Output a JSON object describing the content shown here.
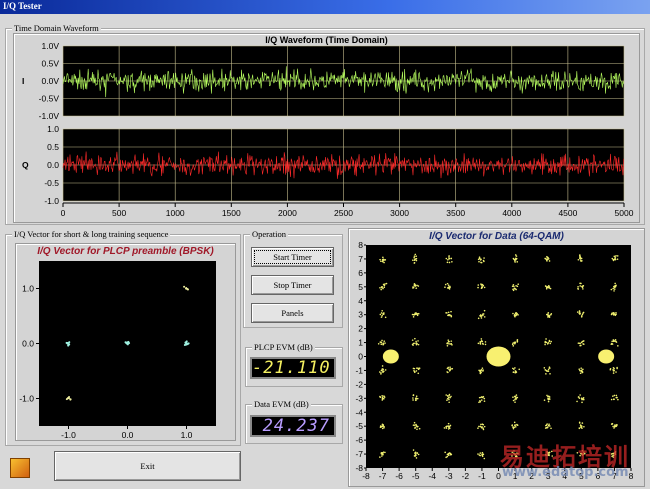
{
  "window": {
    "title": "I/Q Tester"
  },
  "time_group": {
    "label": "Time Domain Waveform",
    "chart_title": "I/Q Waveform (Time Domain)",
    "i_label": "I",
    "q_label": "Q",
    "i_ticks": [
      "1.0V",
      "0.5V",
      "0.0V",
      "-0.5V",
      "-1.0V"
    ],
    "q_ticks": [
      "1.0",
      "0.5",
      "0.0",
      "-0.5",
      "-1.0"
    ],
    "x_ticks": [
      "0",
      "500",
      "1000",
      "1500",
      "2000",
      "2500",
      "3000",
      "3500",
      "4000",
      "4500",
      "5000"
    ],
    "colors": {
      "i": "#b8ff60",
      "q": "#ff2a2a",
      "grid": "#c8c090"
    }
  },
  "preamble_group": {
    "label": "I/Q Vector for short & long training sequence",
    "chart_title": "I/Q Vector for PLCP preamble (BPSK)",
    "y_ticks": [
      "1.0",
      "0.0",
      "-1.0"
    ],
    "x_ticks": [
      "-1.0",
      "0.0",
      "1.0"
    ]
  },
  "operation": {
    "label": "Operation",
    "start": "Start Timer",
    "stop": "Stop Timer",
    "panels": "Panels"
  },
  "plcp_evm": {
    "label": "PLCP EVM (dB)",
    "value": "-21.110",
    "color": "#f4f060"
  },
  "data_evm": {
    "label": "Data EVM (dB)",
    "value": "24.237",
    "color": "#b89cff"
  },
  "exit": {
    "label": "Exit"
  },
  "qam": {
    "chart_title": "I/Q Vector for Data (64-QAM)",
    "y_ticks": [
      "8",
      "7",
      "6",
      "5",
      "4",
      "3",
      "2",
      "1",
      "0",
      "-1",
      "-2",
      "-3",
      "-4",
      "-5",
      "-6",
      "-7",
      "-8"
    ],
    "x_ticks": [
      "-8",
      "-7",
      "-6",
      "-5",
      "-4",
      "-3",
      "-2",
      "-1",
      "0",
      "1",
      "2",
      "3",
      "4",
      "5",
      "6",
      "7",
      "8"
    ]
  },
  "watermark": {
    "cn": "易迪拓培训",
    "url": "www.edatop.com"
  },
  "chart_data": [
    {
      "type": "line",
      "title": "I/Q Waveform (Time Domain)",
      "series": [
        {
          "name": "I",
          "range": [
            -0.6,
            0.6
          ]
        },
        {
          "name": "Q",
          "range": [
            -0.6,
            0.6
          ]
        }
      ],
      "xlim": [
        0,
        5000
      ],
      "ylim": [
        -1,
        1
      ]
    },
    {
      "type": "scatter",
      "title": "I/Q Vector for PLCP preamble (BPSK)",
      "points": [
        [
          -1,
          0
        ],
        [
          0,
          0
        ],
        [
          1,
          0
        ],
        [
          1,
          1
        ],
        [
          -1,
          -1
        ]
      ],
      "xlim": [
        -1.5,
        1.5
      ],
      "ylim": [
        -1.5,
        1.5
      ]
    },
    {
      "type": "scatter",
      "title": "I/Q Vector for Data (64-QAM)",
      "levels": [
        -7,
        -5,
        -3,
        -1,
        1,
        3,
        5,
        7
      ],
      "pilots": [
        [
          -6.5,
          0
        ],
        [
          0,
          0
        ],
        [
          6.5,
          0
        ]
      ],
      "xlim": [
        -8,
        8
      ],
      "ylim": [
        -8,
        8
      ]
    }
  ]
}
